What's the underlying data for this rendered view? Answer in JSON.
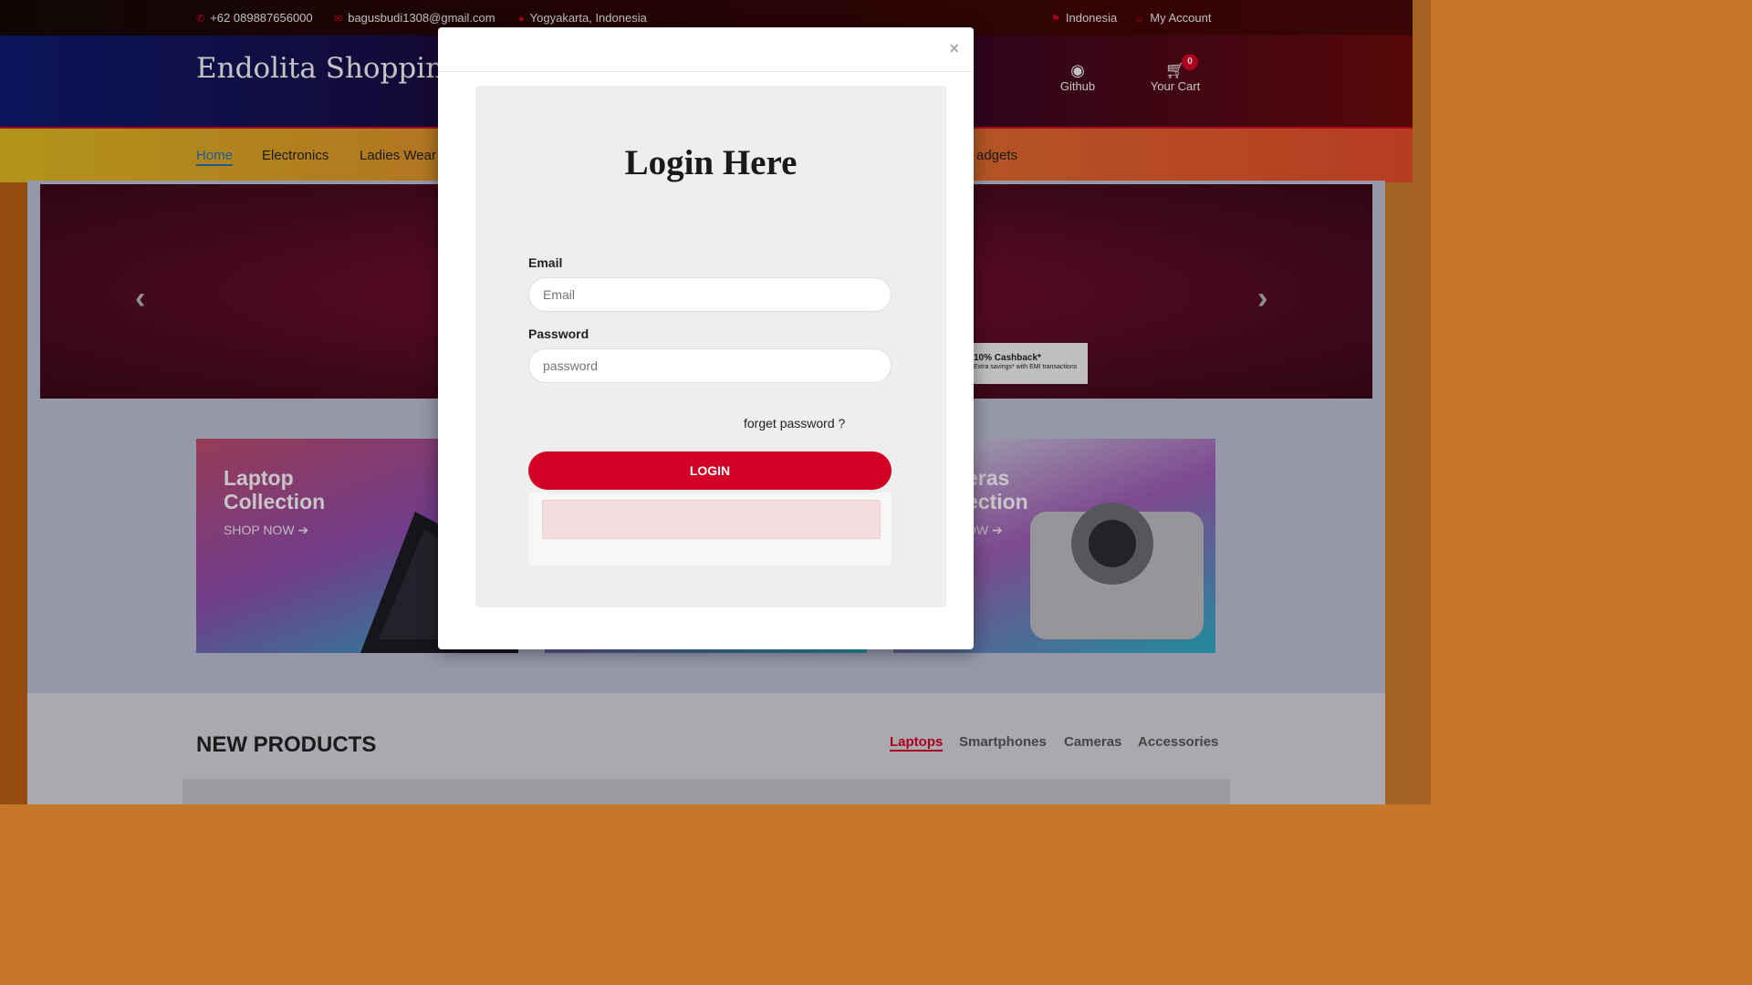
{
  "topbar": {
    "phone": "+62 089887656000",
    "email": "bagusbudi1308@gmail.com",
    "location": "Yogyakarta, Indonesia",
    "country": "Indonesia",
    "account": "My Account"
  },
  "header": {
    "logo": "Endolita Shopping",
    "github_label": "Github",
    "cart_label": "Your Cart",
    "cart_count": "0"
  },
  "nav": {
    "items": [
      "Home",
      "Electronics",
      "Ladies Wear",
      "adgets"
    ]
  },
  "slider": {
    "prev": "‹",
    "next": "›",
    "promo_title": "10% Cashback*",
    "promo_sub": "Extra savings* with EMI transactions"
  },
  "collections": [
    {
      "title_line1": "Laptop",
      "title_line2": "Collection",
      "shop": "SHOP NOW"
    },
    {
      "title_line1": "eras",
      "title_line2": "ection",
      "shop": "OW"
    }
  ],
  "new_products": {
    "title": "NEW PRODUCTS",
    "tabs": [
      "Laptops",
      "Smartphones",
      "Cameras",
      "Accessories"
    ]
  },
  "modal": {
    "close": "×",
    "title": "Login Here",
    "email_label": "Email",
    "email_placeholder": "Email",
    "password_label": "Password",
    "password_placeholder": "password",
    "forgot": "forget password ?",
    "login_button": "LOGIN"
  },
  "colors": {
    "accent": "#d10024",
    "link_active": "#2a6fb0"
  }
}
